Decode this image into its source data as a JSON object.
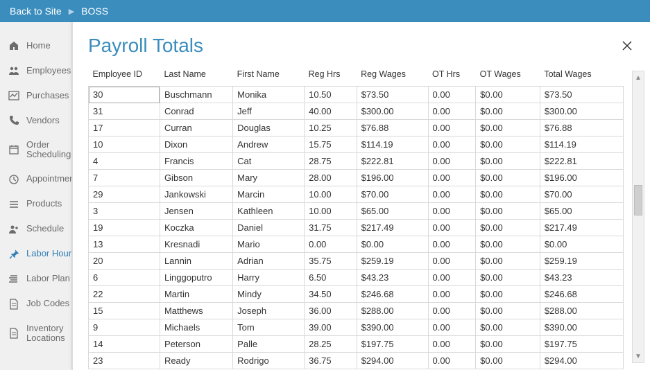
{
  "topbar": {
    "back": "Back to Site",
    "app": "BOSS"
  },
  "sidebar": {
    "items": [
      {
        "icon": "home",
        "label": "Home"
      },
      {
        "icon": "people",
        "label": "Employees"
      },
      {
        "icon": "chart",
        "label": "Purchases"
      },
      {
        "icon": "phone",
        "label": "Vendors"
      },
      {
        "icon": "calendar",
        "label": "Order",
        "label2": "Scheduling"
      },
      {
        "icon": "clock",
        "label": "Appointments"
      },
      {
        "icon": "list",
        "label": "Products"
      },
      {
        "icon": "user-plus",
        "label": "Schedule"
      },
      {
        "icon": "pin",
        "label": "Labor Hours",
        "active": true
      },
      {
        "icon": "lines",
        "label": "Labor Plan"
      },
      {
        "icon": "doc",
        "label": "Job Codes"
      },
      {
        "icon": "doc",
        "label": "Inventory",
        "label2": "Locations"
      }
    ]
  },
  "modal": {
    "title": "Payroll Totals"
  },
  "table": {
    "headers": [
      "Employee ID",
      "Last Name",
      "First Name",
      "Reg Hrs",
      "Reg Wages",
      "OT Hrs",
      "OT Wages",
      "Total Wages"
    ],
    "rows": [
      [
        "30",
        "Buschmann",
        "Monika",
        "10.50",
        "$73.50",
        "0.00",
        "$0.00",
        "$73.50"
      ],
      [
        "31",
        "Conrad",
        "Jeff",
        "40.00",
        "$300.00",
        "0.00",
        "$0.00",
        "$300.00"
      ],
      [
        "17",
        "Curran",
        "Douglas",
        "10.25",
        "$76.88",
        "0.00",
        "$0.00",
        "$76.88"
      ],
      [
        "10",
        "Dixon",
        "Andrew",
        "15.75",
        "$114.19",
        "0.00",
        "$0.00",
        "$114.19"
      ],
      [
        "4",
        "Francis",
        "Cat",
        "28.75",
        "$222.81",
        "0.00",
        "$0.00",
        "$222.81"
      ],
      [
        "7",
        "Gibson",
        "Mary",
        "28.00",
        "$196.00",
        "0.00",
        "$0.00",
        "$196.00"
      ],
      [
        "29",
        "Jankowski",
        "Marcin",
        "10.00",
        "$70.00",
        "0.00",
        "$0.00",
        "$70.00"
      ],
      [
        "3",
        "Jensen",
        "Kathleen",
        "10.00",
        "$65.00",
        "0.00",
        "$0.00",
        "$65.00"
      ],
      [
        "19",
        "Koczka",
        "Daniel",
        "31.75",
        "$217.49",
        "0.00",
        "$0.00",
        "$217.49"
      ],
      [
        "13",
        "Kresnadi",
        "Mario",
        "0.00",
        "$0.00",
        "0.00",
        "$0.00",
        "$0.00"
      ],
      [
        "20",
        "Lannin",
        "Adrian",
        "35.75",
        "$259.19",
        "0.00",
        "$0.00",
        "$259.19"
      ],
      [
        "6",
        "Linggoputro",
        "Harry",
        "6.50",
        "$43.23",
        "0.00",
        "$0.00",
        "$43.23"
      ],
      [
        "22",
        "Martin",
        "Mindy",
        "34.50",
        "$246.68",
        "0.00",
        "$0.00",
        "$246.68"
      ],
      [
        "15",
        "Matthews",
        "Joseph",
        "36.00",
        "$288.00",
        "0.00",
        "$0.00",
        "$288.00"
      ],
      [
        "9",
        "Michaels",
        "Tom",
        "39.00",
        "$390.00",
        "0.00",
        "$0.00",
        "$390.00"
      ],
      [
        "14",
        "Peterson",
        "Palle",
        "28.25",
        "$197.75",
        "0.00",
        "$0.00",
        "$197.75"
      ],
      [
        "23",
        "Ready",
        "Rodrigo",
        "36.75",
        "$294.00",
        "0.00",
        "$0.00",
        "$294.00"
      ]
    ]
  }
}
